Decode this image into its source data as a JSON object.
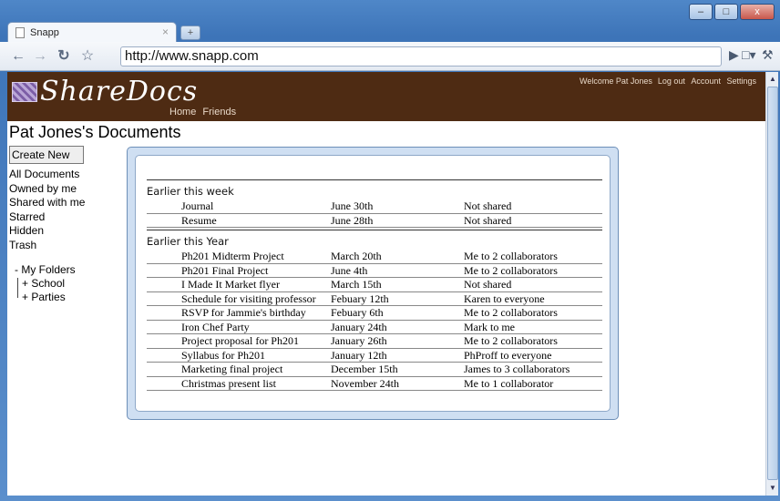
{
  "browser": {
    "tab_title": "Snapp",
    "tab_close": "×",
    "new_tab": "+",
    "url": "http://www.snapp.com",
    "win_minimize": "–",
    "win_maximize": "□",
    "win_close": "x"
  },
  "header": {
    "logo_text": "ShareDocs",
    "nav": [
      "Home",
      "Friends"
    ],
    "welcome": "Welcome Pat Jones",
    "links": [
      "Log out",
      "Account",
      "Settings"
    ]
  },
  "page_title": "Pat Jones's Documents",
  "sidebar": {
    "create_label": "Create New",
    "items": [
      "All Documents",
      "Owned by me",
      "Shared with me",
      "Starred",
      "Hidden",
      "Trash"
    ],
    "folders_root": "- My Folders",
    "folders": [
      "+ School",
      "+ Parties"
    ]
  },
  "documents": {
    "sections": [
      {
        "title": "Earlier this week",
        "rows": [
          {
            "name": "Journal",
            "date": "June 30th",
            "sharing": "Not shared"
          },
          {
            "name": "Resume",
            "date": "June 28th",
            "sharing": "Not shared"
          }
        ]
      },
      {
        "title": "Earlier this Year",
        "rows": [
          {
            "name": "Ph201 Midterm Project",
            "date": "March 20th",
            "sharing": "Me to 2 collaborators"
          },
          {
            "name": "Ph201 Final Project",
            "date": "June 4th",
            "sharing": "Me to 2 collaborators"
          },
          {
            "name": "I Made It Market flyer",
            "date": "March 15th",
            "sharing": "Not shared"
          },
          {
            "name": "Schedule for visiting professor",
            "date": "Febuary 12th",
            "sharing": "Karen to everyone"
          },
          {
            "name": "RSVP for Jammie's birthday",
            "date": "Febuary 6th",
            "sharing": "Me to 2 collaborators"
          },
          {
            "name": "Iron Chef Party",
            "date": "January 24th",
            "sharing": "Mark to me"
          },
          {
            "name": "Project proposal for Ph201",
            "date": "January 26th",
            "sharing": "Me to 2 collaborators"
          },
          {
            "name": "Syllabus for Ph201",
            "date": "January 12th",
            "sharing": "PhProff to everyone"
          },
          {
            "name": "Marketing final project",
            "date": "December 15th",
            "sharing": "James to 3 collaborators"
          },
          {
            "name": "Christmas present list",
            "date": "November 24th",
            "sharing": "Me to 1 collaborator"
          }
        ]
      }
    ]
  }
}
